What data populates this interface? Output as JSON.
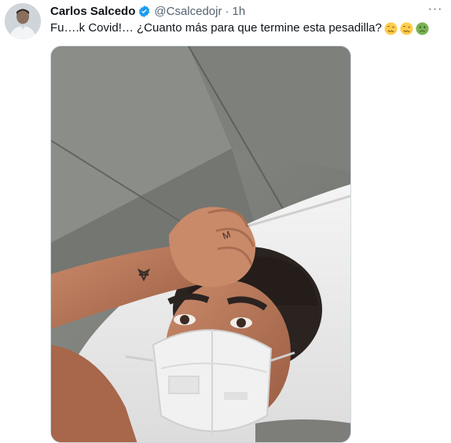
{
  "tweet": {
    "author_name": "Carlos Salcedo",
    "author_handle": "@Csalcedojr",
    "separator": "·",
    "time": "1h",
    "text": "Fu….k Covid!… ¿Cuanto más para que termine esta pesadilla?",
    "emojis": [
      "woozy-face-emoji",
      "woozy-face-emoji",
      "nauseated-face-emoji"
    ],
    "more_label": "···"
  },
  "colors": {
    "verified_badge": "#1d9bf0",
    "secondary_text": "#536471",
    "primary_text": "#0f1419"
  }
}
